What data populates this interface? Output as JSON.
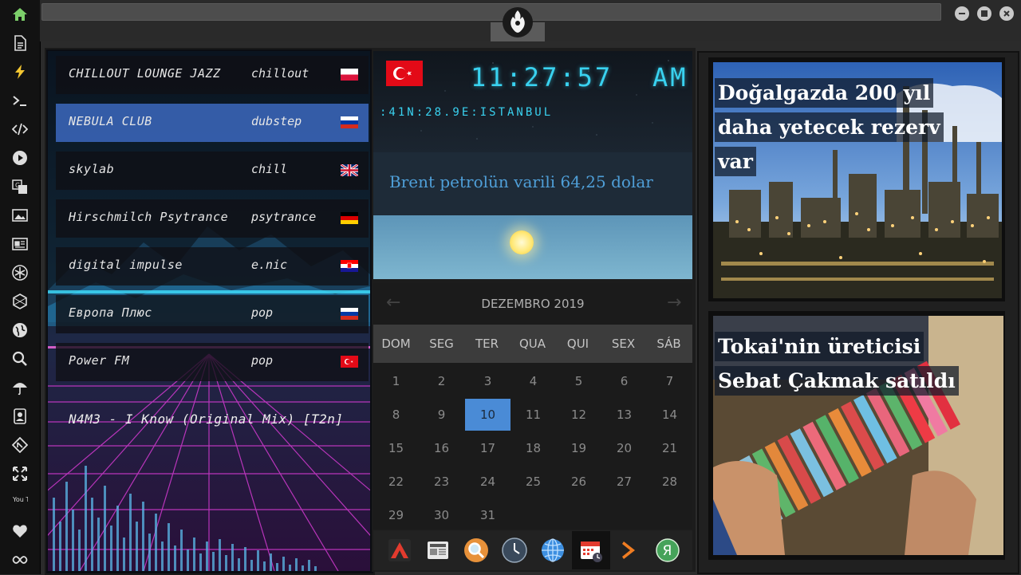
{
  "sidebar": {
    "icons": [
      "home-icon",
      "document-icon",
      "lightning-icon",
      "terminal-icon",
      "code-icon",
      "play-icon",
      "translate-icon",
      "image-icon",
      "news-icon",
      "rebel-icon",
      "hexagon-icon",
      "globe-icon",
      "search-icon",
      "umbrella-icon",
      "contact-icon",
      "git-icon",
      "fullscreen-icon",
      "youtube-icon",
      "heart-icon",
      "infinity-icon"
    ],
    "youtube_label": "You Tube"
  },
  "stations": [
    {
      "name": "CHILLOUT LOUNGE JAZZ",
      "genre": "chillout",
      "flag": "poland",
      "active": false
    },
    {
      "name": "NEBULA CLUB",
      "genre": "dubstep",
      "flag": "russia",
      "active": true
    },
    {
      "name": "skylab",
      "genre": "chill",
      "flag": "uk",
      "active": false
    },
    {
      "name": "Hirschmilch Psytrance",
      "genre": "psytrance",
      "flag": "germany",
      "active": false
    },
    {
      "name": "digital impulse",
      "genre": "e.nic",
      "flag": "croatia",
      "active": false
    },
    {
      "name": "Европа Плюс",
      "genre": "pop",
      "flag": "russia",
      "active": false
    },
    {
      "name": "Power FM",
      "genre": "pop",
      "flag": "turkey",
      "active": false
    }
  ],
  "now_playing": "N4M3 - I Know (Original Mix) [T2n]",
  "clock": {
    "time": "11:27:57",
    "ampm": "AM",
    "location": ":41N:28.9E:ISTANBUL",
    "flag": "turkey"
  },
  "ticker": "Brent petrolün varili 64,25 dolar",
  "calendar": {
    "month": "DEZEMBRO 2019",
    "weekdays": [
      "DOM",
      "SEG",
      "TER",
      "QUA",
      "QUI",
      "SEX",
      "SÁB"
    ],
    "weeks": [
      [
        "1",
        "2",
        "3",
        "4",
        "5",
        "6",
        "7"
      ],
      [
        "8",
        "9",
        "10",
        "11",
        "12",
        "13",
        "14"
      ],
      [
        "15",
        "16",
        "17",
        "18",
        "19",
        "20",
        "21"
      ],
      [
        "22",
        "23",
        "24",
        "25",
        "26",
        "27",
        "28"
      ],
      [
        "29",
        "30",
        "31",
        "",
        "",
        "",
        ""
      ]
    ],
    "today": "10",
    "prev": "←",
    "next": "→"
  },
  "dock": [
    "app-a-icon",
    "news-reader-icon",
    "search-app-icon",
    "clock-app-icon",
    "browser-globe-icon",
    "calendar-app-icon",
    "play-arrow-icon",
    "yandex-icon"
  ],
  "dock_yandex_letter": "Я",
  "news": [
    {
      "lines": [
        "Doğalgazda 200 yıl",
        "daha yetecek rezerv",
        "var"
      ]
    },
    {
      "lines": [
        "Tokai'nin üreticisi",
        "Sebat Çakmak satıldı"
      ]
    }
  ],
  "colors": {
    "accent": "#39d2f0",
    "active_row": "#3c69be",
    "today": "#4a8bd6",
    "ticker": "#4f9fd8"
  }
}
